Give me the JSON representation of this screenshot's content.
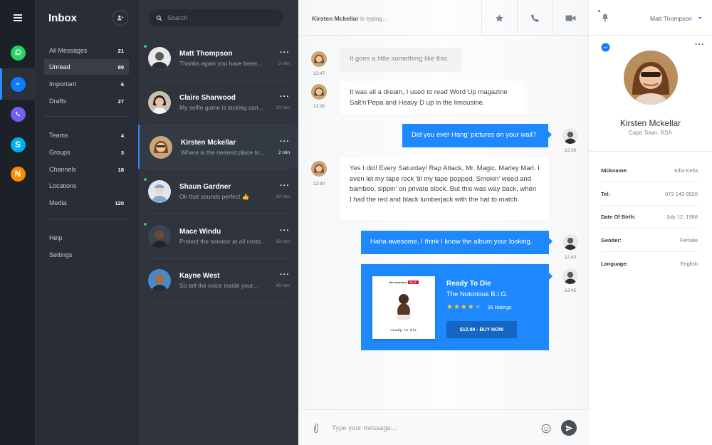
{
  "sidebar": {
    "title": "Inbox",
    "nav_main": [
      {
        "label": "All Messages",
        "count": "21"
      },
      {
        "label": "Unread",
        "count": "89"
      },
      {
        "label": "Important",
        "count": "6"
      },
      {
        "label": "Drafts",
        "count": "27"
      }
    ],
    "nav_groups": [
      {
        "label": "Teams",
        "count": "4"
      },
      {
        "label": "Groups",
        "count": "3"
      },
      {
        "label": "Channels",
        "count": "18"
      },
      {
        "label": "Locations",
        "count": ""
      },
      {
        "label": "Media",
        "count": "120"
      }
    ],
    "nav_footer": [
      {
        "label": "Help"
      },
      {
        "label": "Settings"
      }
    ]
  },
  "apps": [
    {
      "icon": "whatsapp-icon",
      "color": "#25d366"
    },
    {
      "icon": "messenger-icon",
      "color": "#0a7cff"
    },
    {
      "icon": "viber-icon",
      "color": "#7360f2"
    },
    {
      "icon": "skype-icon",
      "color": "#00aff0"
    },
    {
      "icon": "n-app-icon",
      "color": "#ff8a00"
    }
  ],
  "search": {
    "placeholder": "Search"
  },
  "conversations": [
    {
      "name": "Matt Thompson",
      "snippet": "Thanks again you have been...",
      "time": "5 min"
    },
    {
      "name": "Claire Sharwood",
      "snippet": "My selfie game is lacking can...",
      "time": "10 min"
    },
    {
      "name": "Kirsten Mckellar",
      "snippet": "Where is the nearest place to...",
      "time": "2 min"
    },
    {
      "name": "Shaun Gardner",
      "snippet": "Ok that sounds perfect 👍",
      "time": "30 min"
    },
    {
      "name": "Mace Windu",
      "snippet": "Protect the senator at all costs.",
      "time": "38 min"
    },
    {
      "name": "Kayne West",
      "snippet": "So tell the voice inside your...",
      "time": "49 min"
    }
  ],
  "chat": {
    "typing_name": "Kirsten Mckellar",
    "typing_suffix": "is typing...",
    "messages": [
      {
        "dir": "in",
        "text": "It goes a little something like this.",
        "time": "12:47"
      },
      {
        "dir": "in",
        "text": "It was all a dream, I used to read Word Up magazine Salt'n'Pepa and Heavy D up in the limousine.",
        "time": "12:38"
      },
      {
        "dir": "out",
        "text": "Did you ever Hang' pictures on your wall?",
        "time": "12:39"
      },
      {
        "dir": "in",
        "text": "Yes I did! Every Saturday! Rap Attack, Mr. Magic, Marley Marl. I even let my tape rock 'til my tape popped. Smokin' weed and bamboo, sippin' on private stock. But this was way back, when I had the red and black lumberjack with the hat to match.",
        "time": "12:40"
      },
      {
        "dir": "out",
        "text": "Haha awesome,  I think I know the album your looking.",
        "time": "12:43"
      }
    ],
    "card": {
      "time": "12:45",
      "album_top": "the notorious",
      "album_tag": "B.I.G.",
      "album_bottom": "ready to die",
      "title": "Ready To Die",
      "artist": "The Notorious B.I.G.",
      "rating": 4,
      "rating_max": 5,
      "ratings_text": "95 Ratings",
      "buy_label": "$12.99  -  BUY NOW"
    },
    "composer_placeholder": "Type your message..."
  },
  "profile": {
    "user": "Matt Thompson",
    "name": "Kirsten Mckellar",
    "location": "Cape Town, RSA",
    "fields": [
      {
        "key": "Nickname:",
        "value": "Killa Kella"
      },
      {
        "key": "Tel:",
        "value": "072 143 9920"
      },
      {
        "key": "Date Of Birth:",
        "value": "July 12, 1988"
      },
      {
        "key": "Gender:",
        "value": "Female"
      },
      {
        "key": "Language:",
        "value": "English"
      }
    ]
  },
  "colors": {
    "accent": "#1e88ff",
    "online": "#38c66b"
  }
}
